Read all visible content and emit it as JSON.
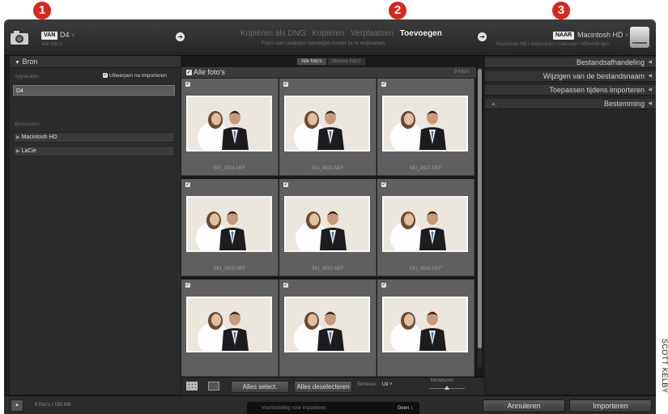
{
  "callouts": [
    "1",
    "2",
    "3"
  ],
  "credit": "SCOTT KELBY",
  "source": {
    "badge": "VAN",
    "name": "D4",
    "caret": "˅",
    "subtitle": "Alle foto's"
  },
  "modes": {
    "items": [
      "Kopiëren als DNG",
      "Kopiëren",
      "Verplaatsen",
      "Toevoegen"
    ],
    "active_index": 3,
    "subtitle": "Foto's aan catalogus toevoegen zonder ze te verplaatsen"
  },
  "destination": {
    "badge": "NAAR",
    "name": "Macintosh HD",
    "caret": "˅",
    "subtitle": "Macintosh HD / Gebruikers / macuser / Afbeeldingen"
  },
  "left_panel": {
    "title": "Bron",
    "devices_label": "Apparaten",
    "eject_label": "Uitwerpen na importeren",
    "device": "D4",
    "files_label": "Bestanden",
    "volumes": [
      "Macintosh HD",
      "LaCie"
    ]
  },
  "center": {
    "tabs": [
      "Alle foto's",
      "Nieuwe foto's"
    ],
    "grid_title": "Alle foto's",
    "photo_count": "9 foto's",
    "photos": [
      "SKI_3624.NEF",
      "SKI_3625.NEF",
      "SKI_3627.NEF",
      "SKI_3629.NEF",
      "SKI_3631.NEF",
      "SKI_3633.NEF",
      "",
      "",
      ""
    ],
    "select_all": "Alles select.",
    "deselect_all": "Alles deselecteren",
    "sort_label": "Sorteren:",
    "sort_value": "Uit ˅",
    "thumbnails_label": "Miniaturen"
  },
  "right_panel": {
    "sections": [
      "Bestandsafhandeling",
      "Wijzigen van de bestandsnaam",
      "Toepassen tijdens importeren",
      "Bestemming"
    ]
  },
  "bottom": {
    "count": "8 foto's / 185 MB",
    "preset_label": "Voorinstelling voor importeren:",
    "preset_value": "Geen ↕",
    "cancel": "Annuleren",
    "import": "Importeren"
  },
  "colors": {
    "callout": "#d9261c",
    "panel": "#2b2b2b",
    "cell": "#5f5f5f"
  }
}
